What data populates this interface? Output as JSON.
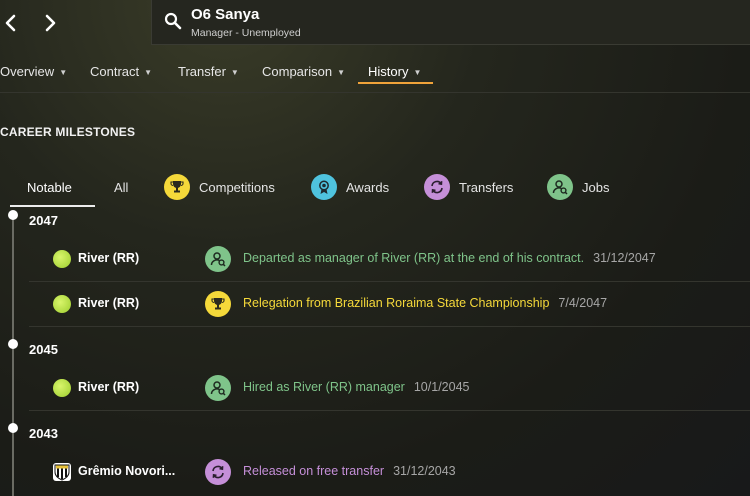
{
  "header": {
    "name": "O6 Sanya",
    "subtitle": "Manager - Unemployed"
  },
  "tabs": [
    {
      "label": "Overview"
    },
    {
      "label": "Contract"
    },
    {
      "label": "Transfer"
    },
    {
      "label": "Comparison"
    },
    {
      "label": "History",
      "active": true
    }
  ],
  "section_title": "CAREER MILESTONES",
  "filters": [
    {
      "label": "Notable",
      "active": true
    },
    {
      "label": "All"
    },
    {
      "label": "Competitions",
      "icon": "trophy-icon",
      "color": "#f5d93a"
    },
    {
      "label": "Awards",
      "icon": "medal-icon",
      "color": "#4fc3de"
    },
    {
      "label": "Transfers",
      "icon": "transfer-icon",
      "color": "#c58fd8"
    },
    {
      "label": "Jobs",
      "icon": "manager-icon",
      "color": "#7fc48a"
    }
  ],
  "timeline": [
    {
      "year": "2047",
      "events": [
        {
          "club": "River (RR)",
          "type": "jobs",
          "text": "Departed as manager of River (RR) at the end of his contract.",
          "date": "31/12/2047"
        },
        {
          "club": "River (RR)",
          "type": "competitions",
          "text": "Relegation from Brazilian Roraima State Championship",
          "date": "7/4/2047"
        }
      ]
    },
    {
      "year": "2045",
      "events": [
        {
          "club": "River (RR)",
          "type": "jobs",
          "text": "Hired as River (RR) manager",
          "date": "10/1/2045"
        }
      ]
    },
    {
      "year": "2043",
      "events": [
        {
          "club": "Grêmio Novori...",
          "type": "transfers",
          "text": "Released on free transfer",
          "date": "31/12/2043"
        }
      ]
    }
  ],
  "colors": {
    "accent": "#f0a33a",
    "jobs": "#7fc48a",
    "competitions": "#f5d93a",
    "transfers": "#c58fd8",
    "awards": "#4fc3de",
    "river_badge": "#c6ea5b"
  }
}
